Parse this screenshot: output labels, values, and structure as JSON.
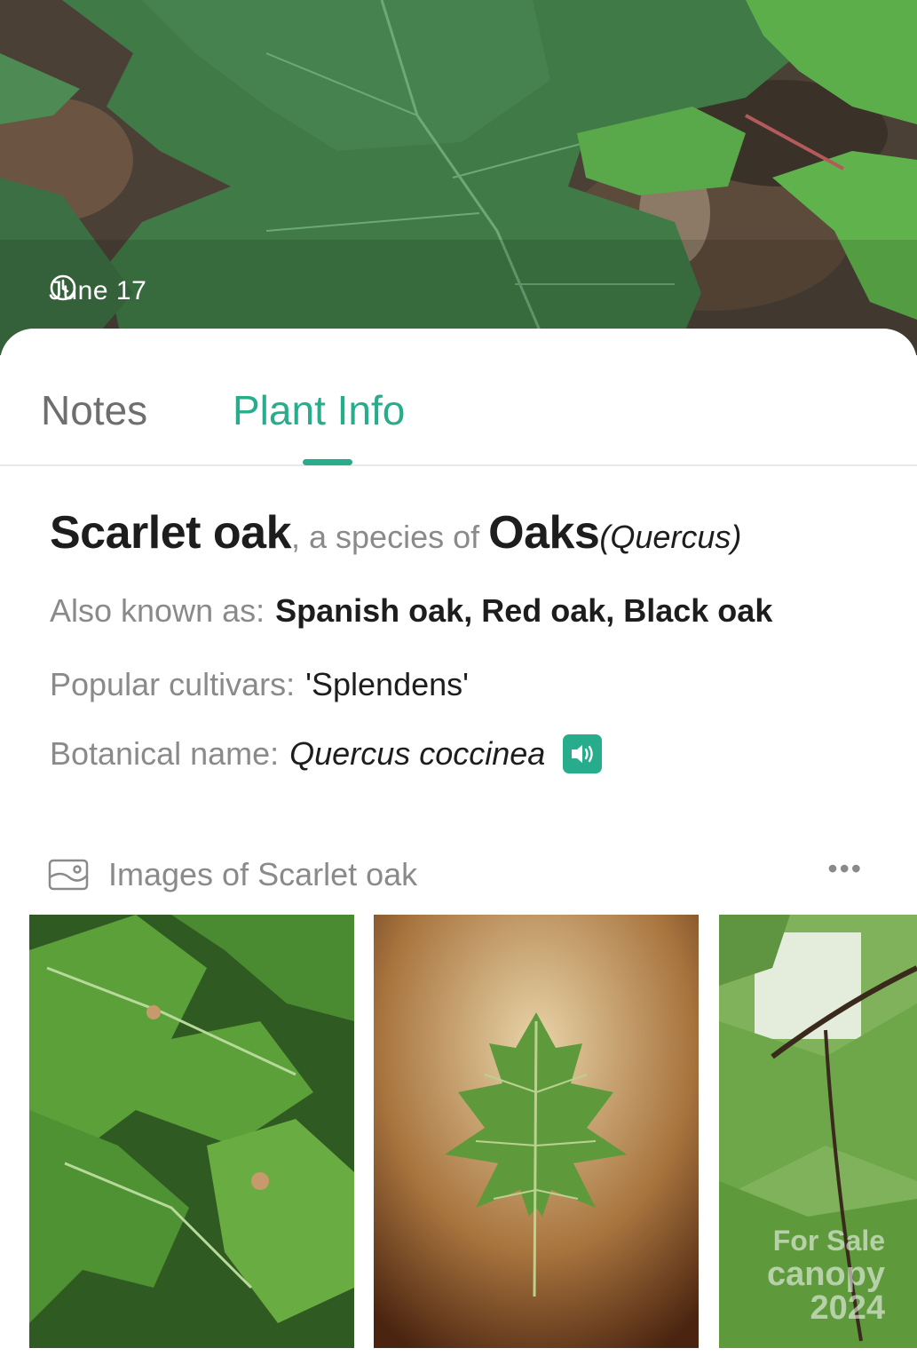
{
  "photo": {
    "date": "June 17",
    "clock_icon": "clock-icon"
  },
  "tabs": [
    {
      "label": "Notes",
      "active": false
    },
    {
      "label": "Plant Info",
      "active": true
    }
  ],
  "accent_color": "#27ad8b",
  "plant": {
    "common_name": "Scarlet oak",
    "species_of_text": ", a species of ",
    "genus": "Oaks",
    "genus_latin": "(Quercus)",
    "aka_label": "Also known as:",
    "aka_value": "Spanish oak, Red oak, Black oak",
    "cultivars_label": "Popular cultivars:",
    "cultivars_value": "'Splendens'",
    "botanical_label": "Botanical name:",
    "botanical_value": "Quercus coccinea",
    "audio_icon": "speaker-icon"
  },
  "images_section": {
    "icon": "image-gallery-icon",
    "title": "Images of Scarlet oak",
    "more_icon": "more-dots-icon",
    "more_text": "•••",
    "watermark_line1": "For Sale",
    "watermark_line2": "canopy 2024"
  }
}
